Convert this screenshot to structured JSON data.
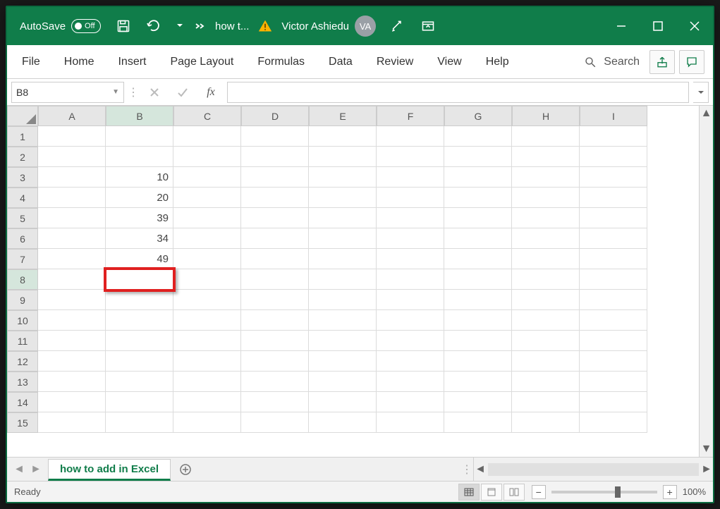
{
  "titlebar": {
    "autosave_label": "AutoSave",
    "autosave_state": "Off",
    "doc_title": "how t...",
    "user_name": "Victor Ashiedu",
    "user_initials": "VA"
  },
  "ribbon": {
    "tabs": [
      "File",
      "Home",
      "Insert",
      "Page Layout",
      "Formulas",
      "Data",
      "Review",
      "View",
      "Help"
    ],
    "search_label": "Search"
  },
  "formula": {
    "namebox": "B8",
    "fx_label": "fx",
    "value": ""
  },
  "grid": {
    "columns": [
      "A",
      "B",
      "C",
      "D",
      "E",
      "F",
      "G",
      "H",
      "I"
    ],
    "rows": [
      1,
      2,
      3,
      4,
      5,
      6,
      7,
      8,
      9,
      10,
      11,
      12,
      13,
      14,
      15
    ],
    "active_col": "B",
    "active_row": 8,
    "cells": {
      "B3": "10",
      "B4": "20",
      "B5": "39",
      "B6": "34",
      "B7": "49"
    }
  },
  "sheetbar": {
    "active_sheet": "how to add in Excel"
  },
  "statusbar": {
    "status": "Ready",
    "zoom": "100%"
  }
}
